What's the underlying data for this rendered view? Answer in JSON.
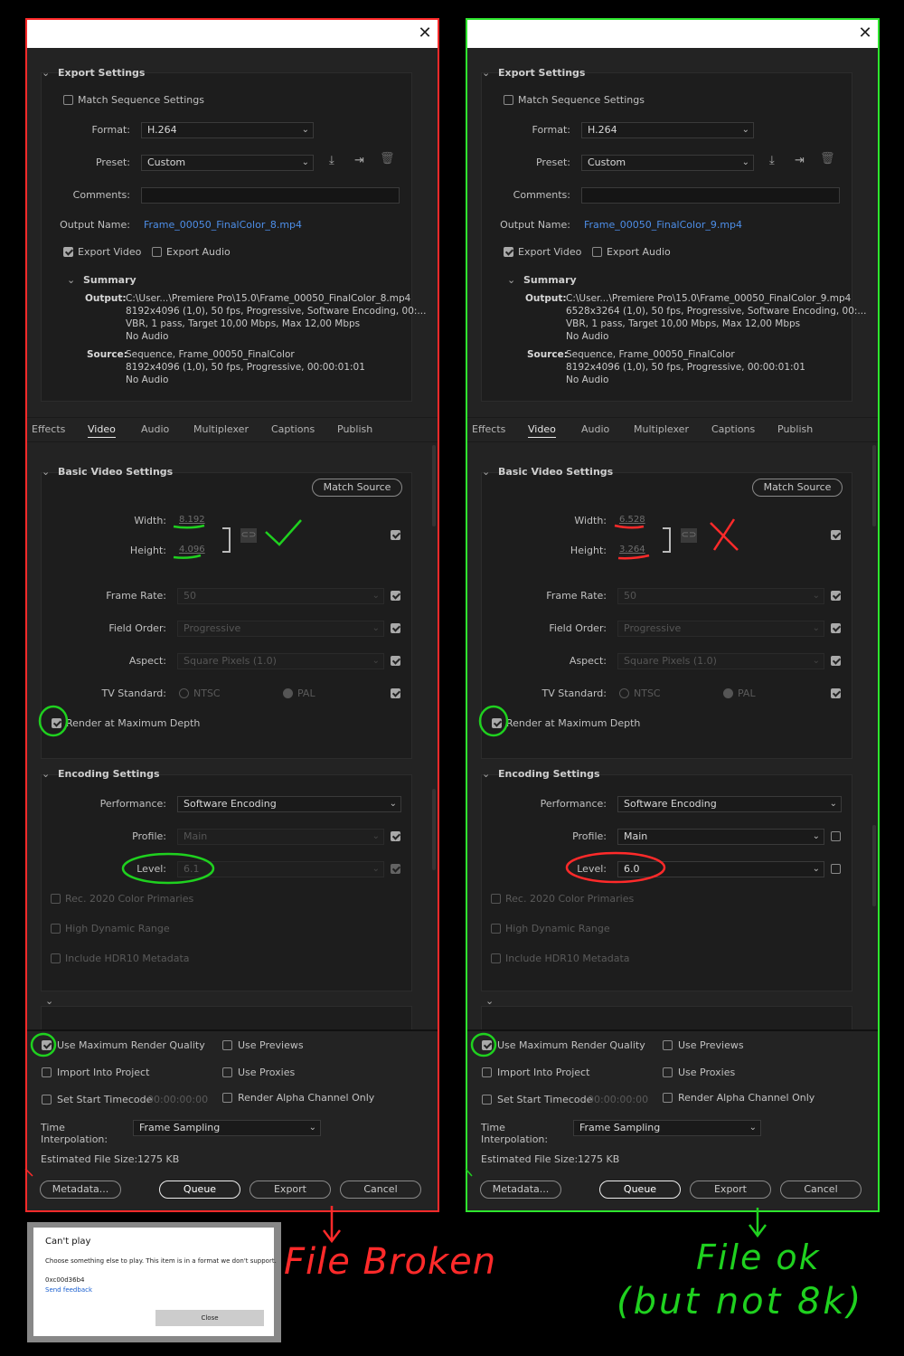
{
  "left": {
    "export_settings_title": "Export Settings",
    "match_sequence": "Match Sequence Settings",
    "format_label": "Format:",
    "format_value": "H.264",
    "preset_label": "Preset:",
    "preset_value": "Custom",
    "comments_label": "Comments:",
    "output_name_label": "Output Name:",
    "output_name": "Frame_00050_FinalColor_8.mp4",
    "export_video": "Export Video",
    "export_audio": "Export Audio",
    "summary_title": "Summary",
    "output_key": "Output:",
    "output_lines": [
      "C:\\User...\\Premiere Pro\\15.0\\Frame_00050_FinalColor_8.mp4",
      "8192x4096 (1,0), 50 fps, Progressive, Software Encoding, 00:...",
      "VBR, 1 pass, Target 10,00 Mbps, Max 12,00 Mbps",
      "No Audio"
    ],
    "source_key": "Source:",
    "source_lines": [
      "Sequence, Frame_00050_FinalColor",
      "8192x4096 (1,0), 50 fps, Progressive, 00:00:01:01",
      "No Audio"
    ],
    "tabs": [
      "Effects",
      "Video",
      "Audio",
      "Multiplexer",
      "Captions",
      "Publish"
    ],
    "basic_video_title": "Basic Video Settings",
    "match_source": "Match Source",
    "width_label": "Width:",
    "width_value": "8.192",
    "height_label": "Height:",
    "height_value": "4.096",
    "frame_rate_label": "Frame Rate:",
    "frame_rate_value": "50",
    "field_order_label": "Field Order:",
    "field_order_value": "Progressive",
    "aspect_label": "Aspect:",
    "aspect_value": "Square Pixels (1.0)",
    "tv_standard_label": "TV Standard:",
    "ntsc": "NTSC",
    "pal": "PAL",
    "render_max_depth": "Render at Maximum Depth",
    "encoding_title": "Encoding Settings",
    "performance_label": "Performance:",
    "performance_value": "Software Encoding",
    "profile_label": "Profile:",
    "profile_value": "Main",
    "level_label": "Level:",
    "level_value": "6.1",
    "rec2020": "Rec. 2020 Color Primaries",
    "hdr": "High Dynamic Range",
    "hdr10": "Include HDR10 Metadata",
    "use_max_render": "Use Maximum Render Quality",
    "use_previews": "Use Previews",
    "import_project": "Import Into Project",
    "use_proxies": "Use Proxies",
    "set_start_tc": "Set Start Timecode",
    "start_tc_value": "00:00:00:00",
    "render_alpha": "Render Alpha Channel Only",
    "time_interp_label": "Time Interpolation:",
    "time_interp_value": "Frame Sampling",
    "est_size_label": "Estimated File Size:",
    "est_size_value": "1275 KB",
    "btn_metadata": "Metadata...",
    "btn_queue": "Queue",
    "btn_export": "Export",
    "btn_cancel": "Cancel"
  },
  "right": {
    "export_settings_title": "Export Settings",
    "match_sequence": "Match Sequence Settings",
    "format_label": "Format:",
    "format_value": "H.264",
    "preset_label": "Preset:",
    "preset_value": "Custom",
    "comments_label": "Comments:",
    "output_name_label": "Output Name:",
    "output_name": "Frame_00050_FinalColor_9.mp4",
    "export_video": "Export Video",
    "export_audio": "Export Audio",
    "summary_title": "Summary",
    "output_key": "Output:",
    "output_lines": [
      "C:\\User...\\Premiere Pro\\15.0\\Frame_00050_FinalColor_9.mp4",
      "6528x3264 (1,0), 50 fps, Progressive, Software Encoding, 00:...",
      "VBR, 1 pass, Target 10,00 Mbps, Max 12,00 Mbps",
      "No Audio"
    ],
    "source_key": "Source:",
    "source_lines": [
      "Sequence, Frame_00050_FinalColor",
      "8192x4096 (1,0), 50 fps, Progressive, 00:00:01:01",
      "No Audio"
    ],
    "tabs": [
      "Effects",
      "Video",
      "Audio",
      "Multiplexer",
      "Captions",
      "Publish"
    ],
    "basic_video_title": "Basic Video Settings",
    "match_source": "Match Source",
    "width_label": "Width:",
    "width_value": "6.528",
    "height_label": "Height:",
    "height_value": "3.264",
    "frame_rate_label": "Frame Rate:",
    "frame_rate_value": "50",
    "field_order_label": "Field Order:",
    "field_order_value": "Progressive",
    "aspect_label": "Aspect:",
    "aspect_value": "Square Pixels (1.0)",
    "tv_standard_label": "TV Standard:",
    "ntsc": "NTSC",
    "pal": "PAL",
    "render_max_depth": "Render at Maximum Depth",
    "encoding_title": "Encoding Settings",
    "performance_label": "Performance:",
    "performance_value": "Software Encoding",
    "profile_label": "Profile:",
    "profile_value": "Main",
    "level_label": "Level:",
    "level_value": "6.0",
    "rec2020": "Rec. 2020 Color Primaries",
    "hdr": "High Dynamic Range",
    "hdr10": "Include HDR10 Metadata",
    "use_max_render": "Use Maximum Render Quality",
    "use_previews": "Use Previews",
    "import_project": "Import Into Project",
    "use_proxies": "Use Proxies",
    "set_start_tc": "Set Start Timecode",
    "start_tc_value": "00:00:00:00",
    "render_alpha": "Render Alpha Channel Only",
    "time_interp_label": "Time Interpolation:",
    "time_interp_value": "Frame Sampling",
    "est_size_label": "Estimated File Size:",
    "est_size_value": "1275 KB",
    "btn_metadata": "Metadata...",
    "btn_queue": "Queue",
    "btn_export": "Export",
    "btn_cancel": "Cancel"
  },
  "error_dialog": {
    "title": "Can't play",
    "message": "Choose something else to play. This item is in a format we don't support.",
    "code": "0xc00d36b4",
    "feedback": "Send feedback",
    "close": "Close"
  },
  "annotations": {
    "broken": "File Broken",
    "ok_line1": "File ok",
    "ok_line2": "(but not 8k)"
  },
  "colors": {
    "left_border": "#ff2a2a",
    "right_border": "#2ee62e",
    "link": "#4d8ee8"
  }
}
